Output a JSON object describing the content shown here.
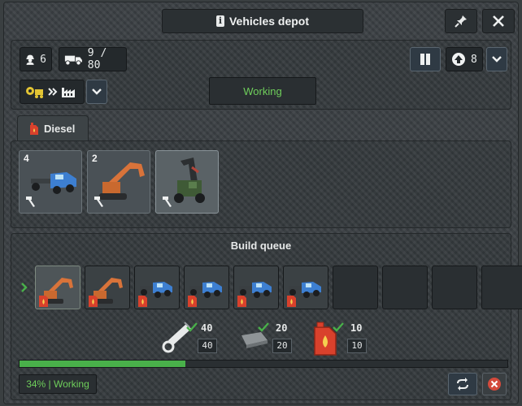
{
  "window": {
    "title": "Vehicles depot"
  },
  "header": {
    "workers_count": "6",
    "trucks_value": "9 / 80",
    "priority_value": "8",
    "status": "Working"
  },
  "tabs": [
    {
      "label": "Diesel"
    }
  ],
  "vehicles": [
    {
      "name": "pickup-truck",
      "count": "4",
      "selected": false
    },
    {
      "name": "excavator",
      "count": "2",
      "selected": false
    },
    {
      "name": "tree-harvester",
      "count": "",
      "selected": true
    }
  ],
  "queue": {
    "title": "Build queue",
    "items": [
      "excavator",
      "excavator",
      "pickup-truck",
      "pickup-truck",
      "pickup-truck",
      "pickup-truck",
      "",
      "",
      "",
      ""
    ]
  },
  "materials": [
    {
      "name": "mechanical-parts",
      "have": "40",
      "need": "40"
    },
    {
      "name": "steel",
      "have": "20",
      "need": "20"
    },
    {
      "name": "diesel",
      "have": "10",
      "need": "10"
    }
  ],
  "progress": {
    "percent": 34,
    "label": "34% | Working"
  },
  "colors": {
    "accent_green": "#6fcf5b",
    "progress_green": "#49b04a",
    "diesel_red": "#d9412c"
  }
}
